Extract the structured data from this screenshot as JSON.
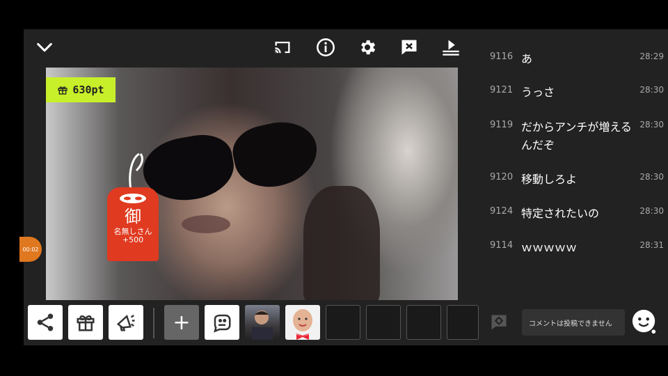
{
  "header": {
    "icons": [
      "chevron-down-icon",
      "cast-icon",
      "info-icon",
      "gear-icon",
      "comment-off-icon",
      "upload-icon"
    ]
  },
  "video": {
    "points_badge": "630pt",
    "charm": {
      "kanji": "御",
      "name": "名無しさん",
      "points": "+500"
    },
    "side_timer": "00:02"
  },
  "toolbar": {
    "buttons": [
      "share-icon",
      "gift-icon",
      "megaphone-icon",
      "plus-icon",
      "sticker-icon"
    ],
    "add_label": "+"
  },
  "chat": {
    "messages": [
      {
        "num": "9116",
        "text": "あ",
        "time": "28:29"
      },
      {
        "num": "9121",
        "text": "うっさ",
        "time": "28:30"
      },
      {
        "num": "9119",
        "text": "だからアンチが増えるんだぞ",
        "time": "28:30"
      },
      {
        "num": "9120",
        "text": "移動しろよ",
        "time": "28:30"
      },
      {
        "num": "9124",
        "text": "特定されたいの",
        "time": "28:30"
      },
      {
        "num": "9114",
        "text": "ｗｗｗｗｗ",
        "time": "28:31"
      }
    ],
    "comment_placeholder": "コメントは投稿できません"
  },
  "colors": {
    "accent_green": "#c8f02a",
    "charm_red": "#e03a20",
    "timer_orange": "#e07820"
  }
}
